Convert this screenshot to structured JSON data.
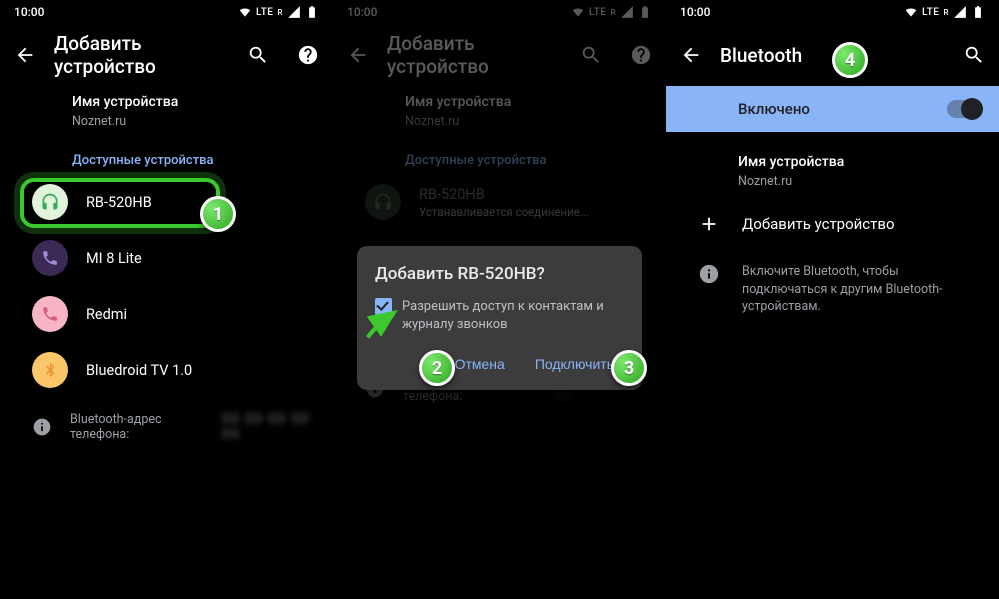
{
  "status": {
    "time": "10:00",
    "lte": "LTE",
    "r": "R"
  },
  "screen1": {
    "title": "Добавить устройство",
    "device_name_label": "Имя устройства",
    "device_name_value": "Noznet.ru",
    "available_label": "Доступные устройства",
    "devices": [
      {
        "name": "RB-520HB",
        "icon": "headphone",
        "bg": "#e2f3dd",
        "fg": "#34a853"
      },
      {
        "name": "MI 8 Lite",
        "icon": "phone",
        "bg": "#3b2b54",
        "fg": "#a78bd6"
      },
      {
        "name": "Redmi",
        "icon": "phone",
        "bg": "#f7b5c4",
        "fg": "#d85a7f"
      },
      {
        "name": "Bluedroid TV 1.0",
        "icon": "bt",
        "bg": "#fbc56a",
        "fg": "#f0902e"
      }
    ],
    "addr_label": "Bluetooth-адрес телефона:"
  },
  "screen2": {
    "title": "Добавить устройство",
    "device_name_label": "Имя устройства",
    "device_name_value": "Noznet.ru",
    "available_label": "Доступные устройства",
    "device": {
      "name": "RB-520HB",
      "sub": "Устанавливается соединение..."
    },
    "addr_label": "Bluetooth-адрес телефона:",
    "dialog": {
      "title": "Добавить RB-520HB?",
      "body": "Разрешить доступ к контактам и журналу звонков",
      "cancel": "Отмена",
      "connect": "Подключить"
    }
  },
  "screen3": {
    "title": "Bluetooth",
    "enabled": "Включено",
    "device_name_label": "Имя устройства",
    "device_name_value": "Noznet.ru",
    "add_device": "Добавить устройство",
    "hint": "Включите Bluetooth, чтобы подключаться к другим Bluetooth-устройствам."
  },
  "steps": {
    "1": "1",
    "2": "2",
    "3": "3",
    "4": "4"
  }
}
